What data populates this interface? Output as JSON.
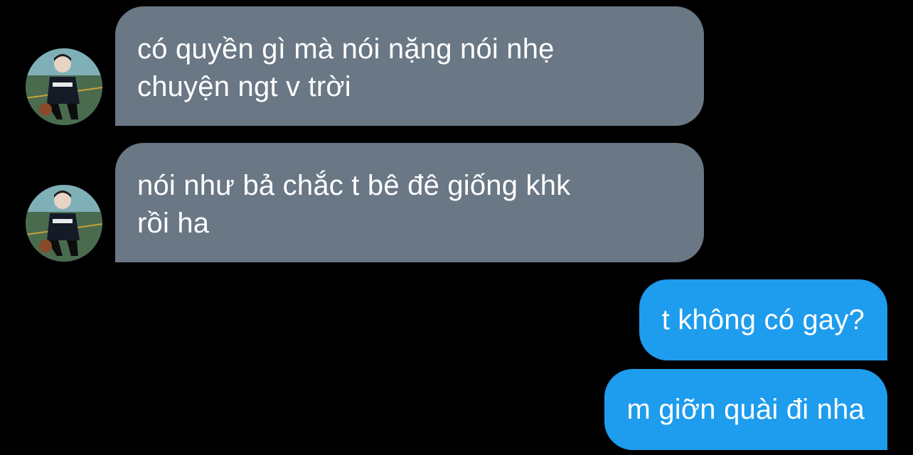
{
  "messages": [
    {
      "direction": "incoming",
      "lines": [
        "có quyền gì mà nói nặng nói nhẹ",
        "chuyện ngt v trời"
      ],
      "avatar_icon": "user-photo-avatar"
    },
    {
      "direction": "incoming",
      "lines": [
        "nói như bả chắc t bê đê giống khk",
        "rồi ha"
      ],
      "avatar_icon": "user-photo-avatar"
    },
    {
      "direction": "outgoing",
      "lines": [
        "t không có gay?"
      ]
    },
    {
      "direction": "outgoing",
      "lines": [
        "m giỡn quài đi nha"
      ]
    }
  ],
  "colors": {
    "background": "#000000",
    "incoming_bubble": "#6a7785",
    "outgoing_bubble": "#1e9cee",
    "text": "#ffffff"
  }
}
